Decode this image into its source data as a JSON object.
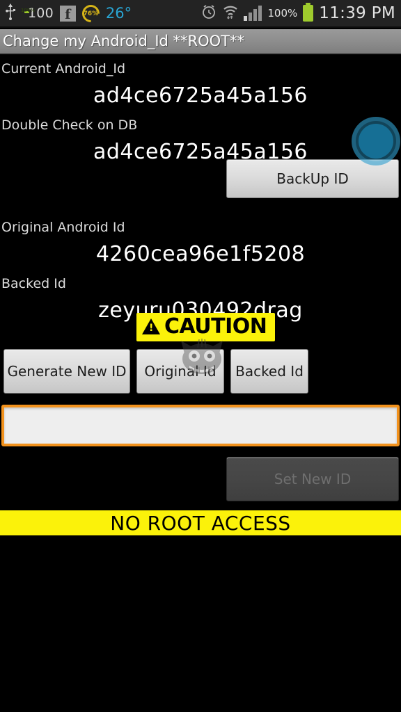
{
  "statusbar": {
    "usb_icon": "usb-icon",
    "battery_icon": "battery-icon",
    "battery_label": "100%",
    "battery_number": "100",
    "facebook_icon": "facebook-icon",
    "facebook_glyph": "f",
    "data_ring_icon": "data-usage-ring-icon",
    "data_ring_label": "76%",
    "temperature": "26°",
    "alarm_icon": "alarm-clock-icon",
    "wifi_icon": "wifi-icon",
    "signal_icon": "cellular-signal-icon",
    "battery_percent": "100%",
    "nav_battery_icon": "battery-icon",
    "clock": "11:39 PM"
  },
  "titlebar": {
    "title": "Change my Android_Id **ROOT**"
  },
  "fields": {
    "current_label": "Current Android_Id",
    "current_value": "ad4ce6725a45a156",
    "double_check_label": "Double Check on DB",
    "double_check_value": "ad4ce6725a45a156",
    "original_label": "Original Android Id",
    "original_value": "4260cea96e1f5208",
    "backed_label": "Backed Id",
    "backed_value": "zeyuru030492drag"
  },
  "buttons": {
    "backup_id": "BackUp ID",
    "generate_new_id": "Generate New ID",
    "original_id": "Original Id",
    "backed_id": "Backed Id",
    "set_new_id": "Set New ID"
  },
  "caution": {
    "icon": "warning-triangle-icon",
    "text": "CAUTION"
  },
  "input": {
    "value": "",
    "placeholder": ""
  },
  "status_banner": {
    "text": "NO ROOT ACCESS"
  },
  "watermark": {
    "icon": "cat-face-watermark-icon"
  },
  "touch_indicator": {
    "icon": "touch-ripple-indicator"
  },
  "colors": {
    "accent_yellow": "#fbf20a",
    "focus_orange": "#f2921d",
    "battery_green": "#9ecb2d",
    "temp_blue": "#29a5d4",
    "background": "#000000"
  }
}
